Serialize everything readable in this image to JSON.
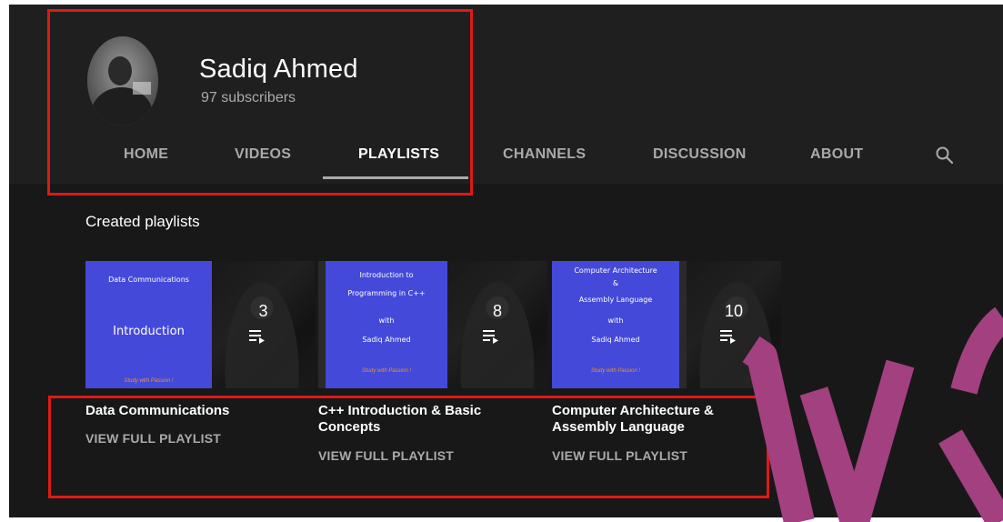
{
  "channel": {
    "name": "Sadiq Ahmed",
    "subscribers": "97 subscribers"
  },
  "tabs": [
    {
      "label": "HOME",
      "active": false
    },
    {
      "label": "VIDEOS",
      "active": false
    },
    {
      "label": "PLAYLISTS",
      "active": true
    },
    {
      "label": "CHANNELS",
      "active": false
    },
    {
      "label": "DISCUSSION",
      "active": false
    },
    {
      "label": "ABOUT",
      "active": false
    }
  ],
  "section": {
    "title": "Created playlists"
  },
  "playlists": [
    {
      "thumb_lines": [
        "Data Communications",
        "Introduction"
      ],
      "thumb_footer": "Study with Passion !",
      "count": "3",
      "title": "Data Communications",
      "link": "VIEW FULL PLAYLIST"
    },
    {
      "thumb_lines": [
        "Introduction to",
        "Programming  in  C++",
        "with",
        "Sadiq Ahmed"
      ],
      "thumb_footer": "Study with Passion !",
      "count": "8",
      "title": "C++ Introduction & Basic Concepts",
      "link": "VIEW FULL PLAYLIST"
    },
    {
      "thumb_lines": [
        "Computer Architecture",
        "&",
        "Assembly Language",
        "with",
        "Sadiq Ahmed"
      ],
      "thumb_footer": "Study with Passion !",
      "count": "10",
      "title": "Computer Architecture & Assembly Language",
      "link": "VIEW FULL PLAYLIST"
    }
  ],
  "colors": {
    "annotation": "#e01818",
    "thumbnail_blue": "#4549d9",
    "watermark": "#a3407f"
  }
}
